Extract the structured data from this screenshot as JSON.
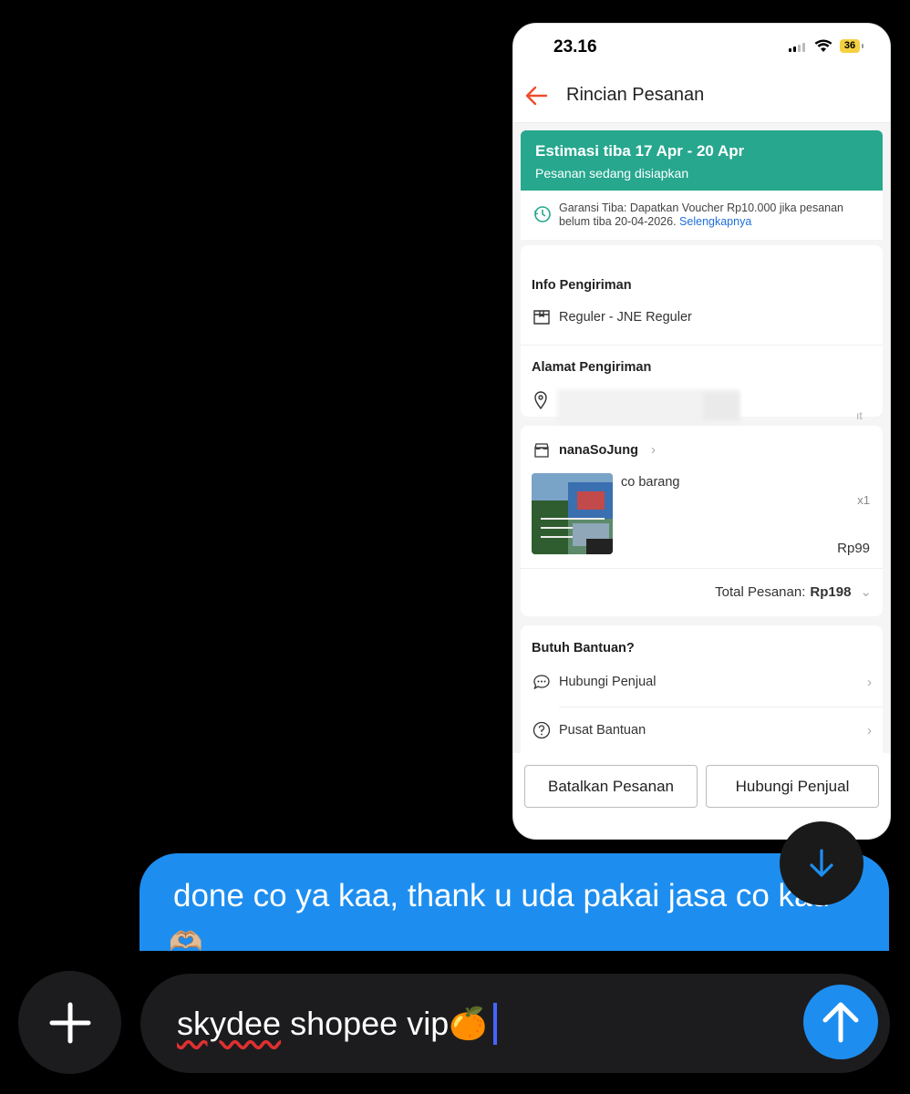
{
  "status_bar": {
    "time": "23.16",
    "battery": "36"
  },
  "app_bar": {
    "title": "Rincian Pesanan"
  },
  "estimate": {
    "headline": "Estimasi tiba 17 Apr - 20 Apr",
    "status": "Pesanan sedang disiapkan"
  },
  "guarantee": {
    "text": "Garansi Tiba: Dapatkan Voucher Rp10.000 jika pesanan belum tiba 20-04-2026.",
    "link": "Selengkapnya"
  },
  "shipping": {
    "info_label": "Info Pengiriman",
    "service": "Reguler - JNE Reguler",
    "address_label": "Alamat Pengiriman",
    "address_fragment": "ıt"
  },
  "order": {
    "shop_name": "nanaSoJung",
    "item_name": "co barang",
    "quantity": "x1",
    "price": "Rp99",
    "total_label": "Total Pesanan:",
    "total_value": "Rp198"
  },
  "help": {
    "label": "Butuh Bantuan?",
    "contact_seller": "Hubungi Penjual",
    "help_center": "Pusat Bantuan"
  },
  "actions": {
    "cancel": "Batalkan Pesanan",
    "contact": "Hubungi Penjual"
  },
  "chat": {
    "message": "done co ya kaa, thank u uda pakai jasa co kau",
    "message_emoji": "🫶🏼"
  },
  "composer": {
    "text_underlined": "skydee",
    "text_rest": " shopee vip",
    "emoji": "🍊"
  },
  "colors": {
    "brand_orange": "#ee4d2d",
    "teal": "#26a78e",
    "bubble_blue": "#1d8ef0",
    "link_blue": "#1e6fd9"
  }
}
